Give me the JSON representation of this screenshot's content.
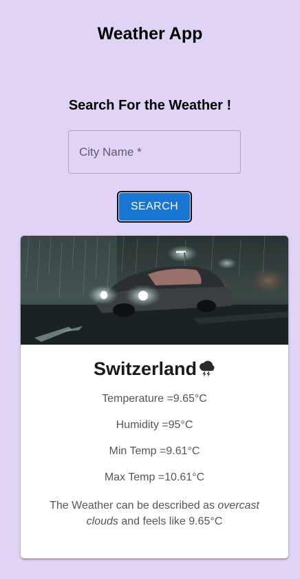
{
  "app": {
    "title": "Weather App"
  },
  "search": {
    "heading": "Search For the Weather !",
    "placeholder": "City Name *",
    "value": "",
    "button_label": "SEARCH"
  },
  "weather": {
    "city": "Switzerland",
    "icon": "thunderstorm-cloud-icon",
    "temperature": "Temperature =9.65°C",
    "humidity": "Humidity =95°C",
    "min_temp": "Min Temp =9.61°C",
    "max_temp": "Max Temp =10.61°C",
    "description_prefix": "The Weather can be described as",
    "description_condition": "overcast clouds",
    "description_suffix": "and feels like 9.65°C"
  },
  "colors": {
    "background": "#e0d3f6",
    "button": "#1976d2",
    "card": "#ffffff"
  }
}
